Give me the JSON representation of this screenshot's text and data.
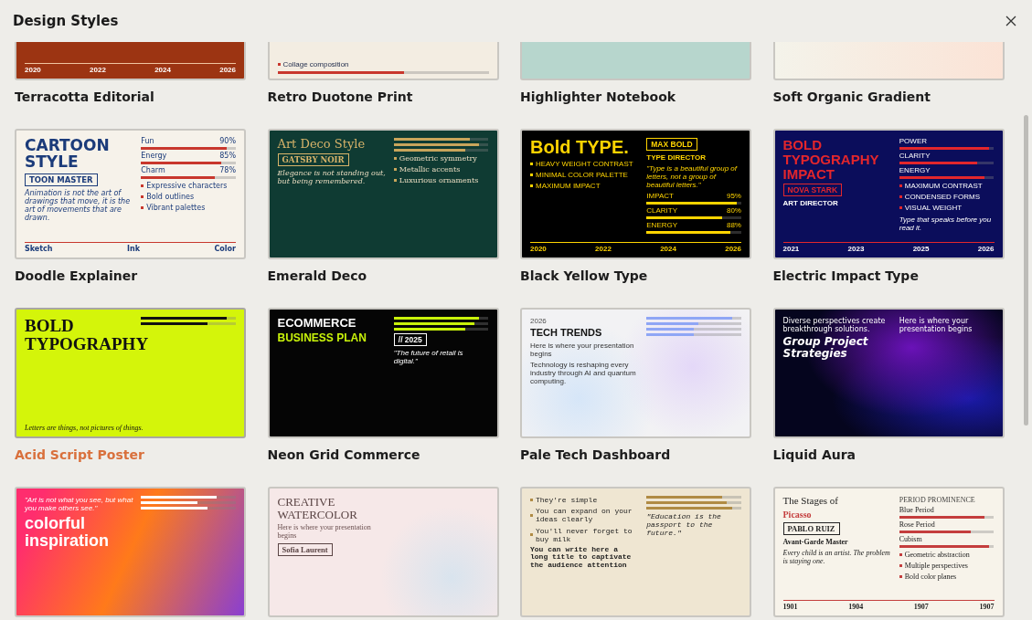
{
  "window": {
    "title": "Design Styles"
  },
  "cards": [
    {
      "title": "Terracotta Editorial",
      "selected": false,
      "thumb": {
        "kind": "terracotta",
        "bottom": [
          {
            "kind": "timeline",
            "labels": [
              "2020",
              "2022",
              "2024",
              "2026"
            ]
          }
        ]
      }
    },
    {
      "title": "Retro Duotone Print",
      "selected": false,
      "thumb": {
        "kind": "retro",
        "bottom": [
          {
            "kind": "bullet",
            "text": "Collage composition"
          },
          {
            "kind": "bar",
            "level": 0.6
          }
        ]
      }
    },
    {
      "title": "Highlighter Notebook",
      "selected": false,
      "thumb": {
        "kind": "highlighter"
      }
    },
    {
      "title": "Soft Organic Gradient",
      "selected": false,
      "thumb": {
        "kind": "organic"
      }
    },
    {
      "title": "Doodle Explainer",
      "selected": false,
      "thumb": {
        "kind": "doodle",
        "left": [
          {
            "kind": "headline",
            "text": "CARTOON STYLE"
          },
          {
            "kind": "name",
            "text": "TOON MASTER"
          },
          {
            "kind": "quote",
            "text": "Animation is not the art of drawings that move, it is the art of movements that are drawn."
          }
        ],
        "right": [
          {
            "kind": "bar",
            "label": "Fun",
            "reading": "90%",
            "level": 0.9
          },
          {
            "kind": "bar",
            "label": "Energy",
            "reading": "85%",
            "level": 0.85
          },
          {
            "kind": "bar",
            "label": "Charm",
            "reading": "78%",
            "level": 0.78
          },
          {
            "kind": "bullet",
            "text": "Expressive characters"
          },
          {
            "kind": "bullet",
            "text": "Bold outlines"
          },
          {
            "kind": "bullet",
            "text": "Vibrant palettes"
          }
        ],
        "bottom": [
          {
            "kind": "timeline",
            "labels": [
              "Sketch",
              "Ink",
              "Color"
            ]
          }
        ]
      }
    },
    {
      "title": "Emerald Deco",
      "selected": false,
      "thumb": {
        "kind": "emerald",
        "left": [
          {
            "kind": "headline",
            "text": "Art Deco Style"
          },
          {
            "kind": "name",
            "text": "GATSBY NOIR"
          },
          {
            "kind": "quote",
            "text": "Elegance is not standing out, but being remembered."
          }
        ],
        "right": [
          {
            "kind": "bar",
            "level": 0.8
          },
          {
            "kind": "bar",
            "level": 0.9
          },
          {
            "kind": "bar",
            "level": 0.75
          },
          {
            "kind": "bullet",
            "text": "Geometric symmetry"
          },
          {
            "kind": "bullet",
            "text": "Metallic accents"
          },
          {
            "kind": "bullet",
            "text": "Luxurious ornaments"
          }
        ]
      }
    },
    {
      "title": "Black Yellow Type",
      "selected": false,
      "thumb": {
        "kind": "blackyellow",
        "left": [
          {
            "kind": "headline",
            "text": "Bold TYPE."
          },
          {
            "kind": "bullet",
            "text": "HEAVY WEIGHT CONTRAST"
          },
          {
            "kind": "bullet",
            "text": "MINIMAL COLOR PALETTE"
          },
          {
            "kind": "bullet",
            "text": "MAXIMUM IMPACT"
          }
        ],
        "right": [
          {
            "kind": "name",
            "text": "MAX BOLD"
          },
          {
            "kind": "role",
            "text": "TYPE DIRECTOR"
          },
          {
            "kind": "quote",
            "text": "\"Type is a beautiful group of letters, not a group of beautiful letters.\""
          },
          {
            "kind": "bar",
            "label": "IMPACT",
            "reading": "95%",
            "level": 0.95
          },
          {
            "kind": "bar",
            "label": "CLARITY",
            "reading": "80%",
            "level": 0.8
          },
          {
            "kind": "bar",
            "label": "ENERGY",
            "reading": "88%",
            "level": 0.88
          }
        ],
        "bottom": [
          {
            "kind": "timeline",
            "labels": [
              "2020",
              "2022",
              "2024",
              "2026"
            ]
          }
        ]
      }
    },
    {
      "title": "Electric Impact Type",
      "selected": false,
      "thumb": {
        "kind": "electric",
        "left": [
          {
            "kind": "headline",
            "text": "BOLD TYPOGRAPHY IMPACT"
          },
          {
            "kind": "name",
            "text": "NOVA STARK"
          },
          {
            "kind": "role",
            "text": "ART DIRECTOR"
          }
        ],
        "right": [
          {
            "kind": "bar",
            "label": "POWER",
            "level": 0.95
          },
          {
            "kind": "bar",
            "label": "CLARITY",
            "level": 0.82
          },
          {
            "kind": "bar",
            "label": "ENERGY",
            "level": 0.9
          },
          {
            "kind": "bullet",
            "text": "MAXIMUM CONTRAST"
          },
          {
            "kind": "bullet",
            "text": "CONDENSED FORMS"
          },
          {
            "kind": "bullet",
            "text": "VISUAL WEIGHT"
          },
          {
            "kind": "quote",
            "text": "Type that speaks before you read it."
          }
        ],
        "bottom": [
          {
            "kind": "timeline",
            "labels": [
              "2021",
              "2023",
              "2025",
              "2026"
            ]
          }
        ]
      }
    },
    {
      "title": "Acid Script Poster",
      "selected": true,
      "thumb": {
        "kind": "acid",
        "left": [
          {
            "kind": "headline",
            "text": "BOLD TYPOGRAPHY"
          }
        ],
        "right": [
          {
            "kind": "bar",
            "level": 0.9
          },
          {
            "kind": "bar",
            "level": 0.7
          }
        ],
        "bottom": [
          {
            "kind": "quote",
            "text": "Letters are things, not pictures of things."
          }
        ]
      }
    },
    {
      "title": "Neon Grid Commerce",
      "selected": false,
      "thumb": {
        "kind": "neon",
        "left": [
          {
            "kind": "headline",
            "text": "ECOMMERCE"
          },
          {
            "kind": "subhead",
            "text": "BUSINESS PLAN"
          }
        ],
        "right": [
          {
            "kind": "bar",
            "level": 0.9
          },
          {
            "kind": "bar",
            "level": 0.85
          },
          {
            "kind": "bar",
            "level": 0.75
          },
          {
            "kind": "name",
            "text": "// 2025"
          },
          {
            "kind": "quote",
            "text": "\"The future of retail is digital.\""
          }
        ]
      }
    },
    {
      "title": "Pale Tech Dashboard",
      "selected": false,
      "thumb": {
        "kind": "paletech",
        "left": [
          {
            "kind": "eyebrow",
            "text": "2026"
          },
          {
            "kind": "headline",
            "text": "TECH TRENDS"
          },
          {
            "kind": "text",
            "text": "Here is where your presentation begins"
          },
          {
            "kind": "text",
            "text": "Technology is reshaping every industry through AI and quantum computing."
          }
        ],
        "right": [
          {
            "kind": "bar",
            "level": 0.9
          },
          {
            "kind": "bar",
            "level": 0.55
          },
          {
            "kind": "bar",
            "level": 0.5
          },
          {
            "kind": "bar",
            "level": 0.5
          }
        ]
      }
    },
    {
      "title": "Liquid Aura",
      "selected": false,
      "thumb": {
        "kind": "aura",
        "left": [
          {
            "kind": "text",
            "text": "Diverse perspectives create breakthrough solutions."
          },
          {
            "kind": "headline",
            "text": "Group Project Strategies"
          }
        ],
        "right": [
          {
            "kind": "text",
            "text": "Here is where your presentation begins"
          }
        ]
      }
    },
    {
      "selected": false,
      "thumb": {
        "kind": "colorful",
        "left": [
          {
            "kind": "quote",
            "text": "\"Art is not what you see, but what you make others see.\""
          },
          {
            "kind": "headline",
            "text": "colorful inspiration"
          }
        ],
        "right": [
          {
            "kind": "bar",
            "level": 0.8
          },
          {
            "kind": "bar",
            "level": 0.6
          },
          {
            "kind": "bar",
            "level": 0.7
          }
        ]
      }
    },
    {
      "selected": false,
      "thumb": {
        "kind": "watercolor",
        "left": [
          {
            "kind": "headline",
            "text": "CREATIVE WATERCOLOR"
          },
          {
            "kind": "text",
            "text": "Here is where your presentation begins"
          },
          {
            "kind": "name",
            "text": "Sofia Laurent"
          }
        ]
      }
    },
    {
      "selected": false,
      "thumb": {
        "kind": "typewriter",
        "left": [
          {
            "kind": "bullet",
            "text": "They're simple"
          },
          {
            "kind": "bullet",
            "text": "You can expand on your ideas clearly"
          },
          {
            "kind": "bullet",
            "text": "You'll never forget to buy milk"
          },
          {
            "kind": "headline",
            "text": "You can write here a long title to captivate the audience attention"
          }
        ],
        "right": [
          {
            "kind": "bar",
            "level": 0.8
          },
          {
            "kind": "bar",
            "level": 0.85
          },
          {
            "kind": "bar",
            "level": 0.9
          },
          {
            "kind": "quote",
            "text": "\"Education is the passport to the future.\""
          }
        ]
      }
    },
    {
      "selected": false,
      "thumb": {
        "kind": "picasso",
        "left": [
          {
            "kind": "headline",
            "text": "The Stages of"
          },
          {
            "kind": "subhead",
            "text": "Picasso"
          },
          {
            "kind": "name",
            "text": "PABLO RUIZ"
          },
          {
            "kind": "role",
            "text": "Avant-Garde Master"
          },
          {
            "kind": "quote",
            "text": "Every child is an artist. The problem is staying one."
          }
        ],
        "right": [
          {
            "kind": "eyebrow",
            "text": "PERIOD PROMINENCE"
          },
          {
            "kind": "bar",
            "label": "Blue Period",
            "level": 0.9
          },
          {
            "kind": "bar",
            "label": "Rose Period",
            "level": 0.75
          },
          {
            "kind": "bar",
            "label": "Cubism",
            "level": 0.95
          },
          {
            "kind": "bullet",
            "text": "Geometric abstraction"
          },
          {
            "kind": "bullet",
            "text": "Multiple perspectives"
          },
          {
            "kind": "bullet",
            "text": "Bold color planes"
          }
        ],
        "bottom": [
          {
            "kind": "timeline",
            "labels": [
              "1901",
              "1904",
              "1907",
              "1907"
            ]
          }
        ]
      }
    }
  ]
}
